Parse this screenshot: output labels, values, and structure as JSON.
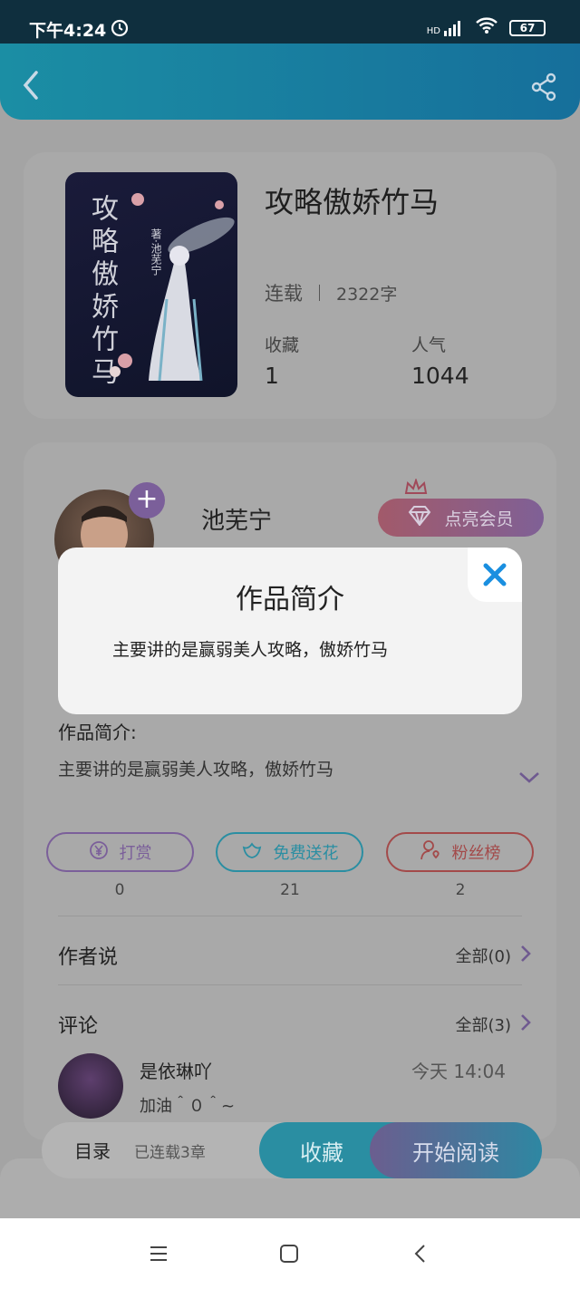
{
  "status_bar": {
    "time": "下午4:24",
    "network": "HD",
    "battery": "67"
  },
  "book": {
    "title": "攻略傲娇竹马",
    "status": "连载",
    "word_count": "2322字",
    "cover_title": "攻略傲娇竹马",
    "cover_author": "著·池芜宁",
    "favorites_label": "收藏",
    "favorites_value": "1",
    "popularity_label": "人气",
    "popularity_value": "1044"
  },
  "author": {
    "name": "池芜宁",
    "vip_label": "点亮会员"
  },
  "intro": {
    "label": "作品简介:",
    "text": "主要讲的是赢弱美人攻略，傲娇竹马"
  },
  "actions": [
    {
      "label": "打赏",
      "count": "0",
      "color": "#7b5f9a"
    },
    {
      "label": "免费送花",
      "count": "21",
      "color": "#2a8ea2"
    },
    {
      "label": "粉丝榜",
      "count": "2",
      "color": "#a34a4a"
    }
  ],
  "author_says": {
    "title": "作者说",
    "link": "全部(0)"
  },
  "comments": {
    "title": "评论",
    "link": "全部(3)",
    "items": [
      {
        "user": "是依琳吖",
        "time": "今天 14:04",
        "text": "加油＾０＾~"
      }
    ]
  },
  "bottom_bar": {
    "toc": "目录",
    "toc_sub": "已连载3章",
    "favorite": "收藏",
    "start_reading": "开始阅读"
  },
  "modal": {
    "title": "作品简介",
    "text": "主要讲的是赢弱美人攻略，傲娇竹马"
  },
  "colors": {
    "accent": "#1b8ea4",
    "modal_close": "#1a8fe0"
  }
}
